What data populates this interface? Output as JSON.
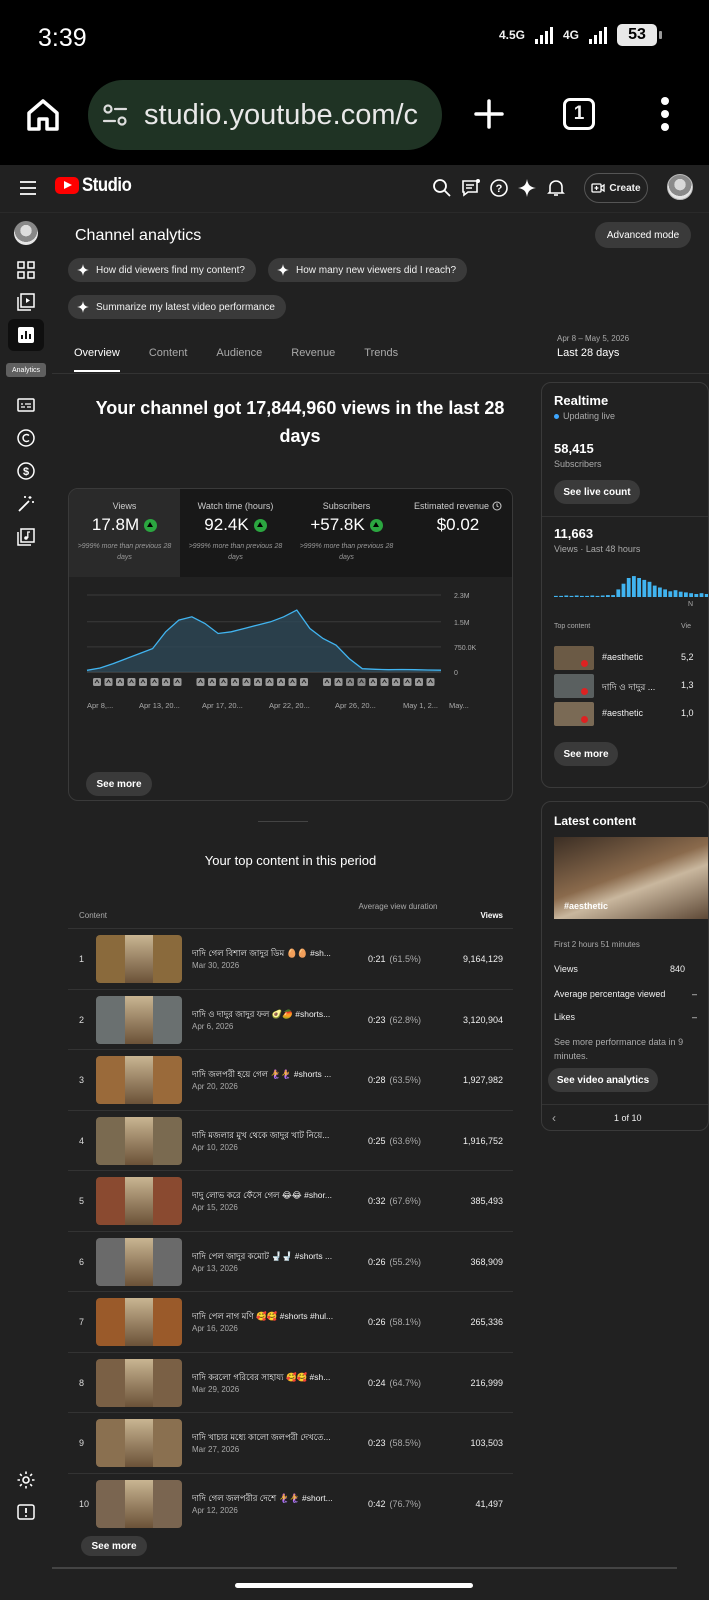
{
  "status": {
    "time": "3:39",
    "net1": "4.5G",
    "net2": "4G",
    "battery": "53"
  },
  "browser": {
    "url": "studio.youtube.com/c",
    "tab_count": "1"
  },
  "studio": {
    "logo_text": "Studio",
    "create_label": "Create"
  },
  "rail": {
    "tooltip": "Analytics"
  },
  "page": {
    "title": "Channel analytics",
    "advanced_mode": "Advanced mode",
    "chips": [
      "How did viewers find my content?",
      "How many new viewers did I reach?",
      "Summarize my latest video performance"
    ],
    "tabs": [
      "Overview",
      "Content",
      "Audience",
      "Revenue",
      "Trends"
    ],
    "date_range": "Apr 8 – May 5, 2026",
    "date_label": "Last 28 days",
    "headline": "Your channel got 17,844,960 views in the last 28 days"
  },
  "metrics": [
    {
      "label": "Views",
      "value": "17.8M",
      "sub": ">999% more than previous 28 days"
    },
    {
      "label": "Watch time (hours)",
      "value": "92.4K",
      "sub": ">999% more than previous 28 days"
    },
    {
      "label": "Subscribers",
      "value": "+57.8K",
      "sub": ">999% more than previous 28 days"
    },
    {
      "label": "Estimated revenue",
      "value": "$0.02",
      "sub": ""
    }
  ],
  "chart_data": {
    "type": "area",
    "y_ticks": [
      "2.3M",
      "1.5M",
      "750.0K",
      "0"
    ],
    "ylim": [
      0,
      2300000
    ],
    "x_tick_labels": [
      "Apr 8,...",
      "Apr 13, 20...",
      "Apr 17, 20...",
      "Apr 22, 20...",
      "Apr 26, 20...",
      "May 1, 2...",
      "May..."
    ],
    "series": [
      {
        "values": [
          50000,
          120000,
          250000,
          400000,
          550000,
          700000,
          1200000,
          1550000,
          1650000,
          1450000,
          1150000,
          1200000,
          1300000,
          1400000,
          1500000,
          1650000,
          1850000,
          1300000,
          1000000,
          800000,
          400000,
          100000,
          80000,
          70000,
          75000,
          70000,
          60000,
          55000
        ]
      }
    ],
    "grid": true
  },
  "see_more": "See more",
  "top_content": {
    "title": "Your top content in this period",
    "col_content": "Content",
    "col_avd": "Average view duration",
    "col_views": "Views",
    "rows": [
      {
        "rank": "1",
        "title": "দাদি গেল বিশাল জাদুর ডিম 🥚🥚 #sh...",
        "date": "Mar 30, 2026",
        "avd": "0:21",
        "pct": "(61.5%)",
        "views": "9,164,129"
      },
      {
        "rank": "2",
        "title": "দাদি ও দাদুর জাদুর ফল 🥑🥭 #shorts...",
        "date": "Apr 6, 2026",
        "avd": "0:23",
        "pct": "(62.8%)",
        "views": "3,120,904"
      },
      {
        "rank": "3",
        "title": "দাদি জলপরী হয়ে গেল 🧜‍♀️🧜‍♀️ #shorts ...",
        "date": "Apr 20, 2026",
        "avd": "0:28",
        "pct": "(63.5%)",
        "views": "1,927,982"
      },
      {
        "rank": "4",
        "title": "দাদি মজলার মুখ থেকে জাদুর খাট নিয়ে...",
        "date": "Apr 10, 2026",
        "avd": "0:25",
        "pct": "(63.6%)",
        "views": "1,916,752"
      },
      {
        "rank": "5",
        "title": "দাদু লোভ করে ফেঁসে গেল 😂😂 #shor...",
        "date": "Apr 15, 2026",
        "avd": "0:32",
        "pct": "(67.6%)",
        "views": "385,493"
      },
      {
        "rank": "6",
        "title": "দাদি পেল জাদুর কমোট 🚽🚽 #shorts ...",
        "date": "Apr 13, 2026",
        "avd": "0:26",
        "pct": "(55.2%)",
        "views": "368,909"
      },
      {
        "rank": "7",
        "title": "দাদি পেল নাগ মণি 🥰🥰 #shorts #hul...",
        "date": "Apr 16, 2026",
        "avd": "0:26",
        "pct": "(58.1%)",
        "views": "265,336"
      },
      {
        "rank": "8",
        "title": "দাদি করলো গরিবের সাহায্য 🥰🥰 #sh...",
        "date": "Mar 29, 2026",
        "avd": "0:24",
        "pct": "(64.7%)",
        "views": "216,999"
      },
      {
        "rank": "9",
        "title": "দাদি খাচার মধ্যে কালো জলপরী দেখতে...",
        "date": "Mar 27, 2026",
        "avd": "0:23",
        "pct": "(58.5%)",
        "views": "103,503"
      },
      {
        "rank": "10",
        "title": "দাদি গেল জলপরীর দেশে 🧜‍♀️🧜‍♀️ #short...",
        "date": "Apr 12, 2026",
        "avd": "0:42",
        "pct": "(76.7%)",
        "views": "41,497"
      }
    ],
    "thumb_colors": [
      "#8a6a3c",
      "#6a7070",
      "#9a6a3a",
      "#7a6a50",
      "#8a4a30",
      "#6a6a6a",
      "#9a5a2a",
      "#7a6045",
      "#8a7050",
      "#7a6550"
    ]
  },
  "realtime": {
    "title": "Realtime",
    "live": "Updating live",
    "subs": "58,415",
    "subs_label": "Subscribers",
    "live_count_btn": "See live count",
    "views": "11,663",
    "views_label": "Views · Last 48 hours",
    "axis_now": "N",
    "bars": [
      0.03,
      0.03,
      0.04,
      0.03,
      0.04,
      0.03,
      0.03,
      0.04,
      0.03,
      0.04,
      0.05,
      0.05,
      0.2,
      0.35,
      0.5,
      0.55,
      0.5,
      0.45,
      0.4,
      0.3,
      0.25,
      0.2,
      0.15,
      0.18,
      0.14,
      0.12,
      0.1,
      0.08,
      0.1,
      0.08
    ],
    "top_content_label": "Top content",
    "views_col": "Vie",
    "items": [
      {
        "title": "#aesthetic",
        "value": "5,2"
      },
      {
        "title": "দাদি ও দাদুর ...",
        "value": "1,3"
      },
      {
        "title": "#aesthetic",
        "value": "1,0"
      }
    ]
  },
  "latest": {
    "title": "Latest content",
    "thumb_caption": "#aesthetic",
    "meta": "First 2 hours 51 minutes",
    "stats": [
      {
        "k": "Views",
        "v": "840"
      },
      {
        "k": "Average percentage viewed",
        "v": "–"
      },
      {
        "k": "Likes",
        "v": "–"
      }
    ],
    "note": "See more performance data in 9 minutes.",
    "btn": "See video analytics",
    "pager": "1 of 10"
  }
}
